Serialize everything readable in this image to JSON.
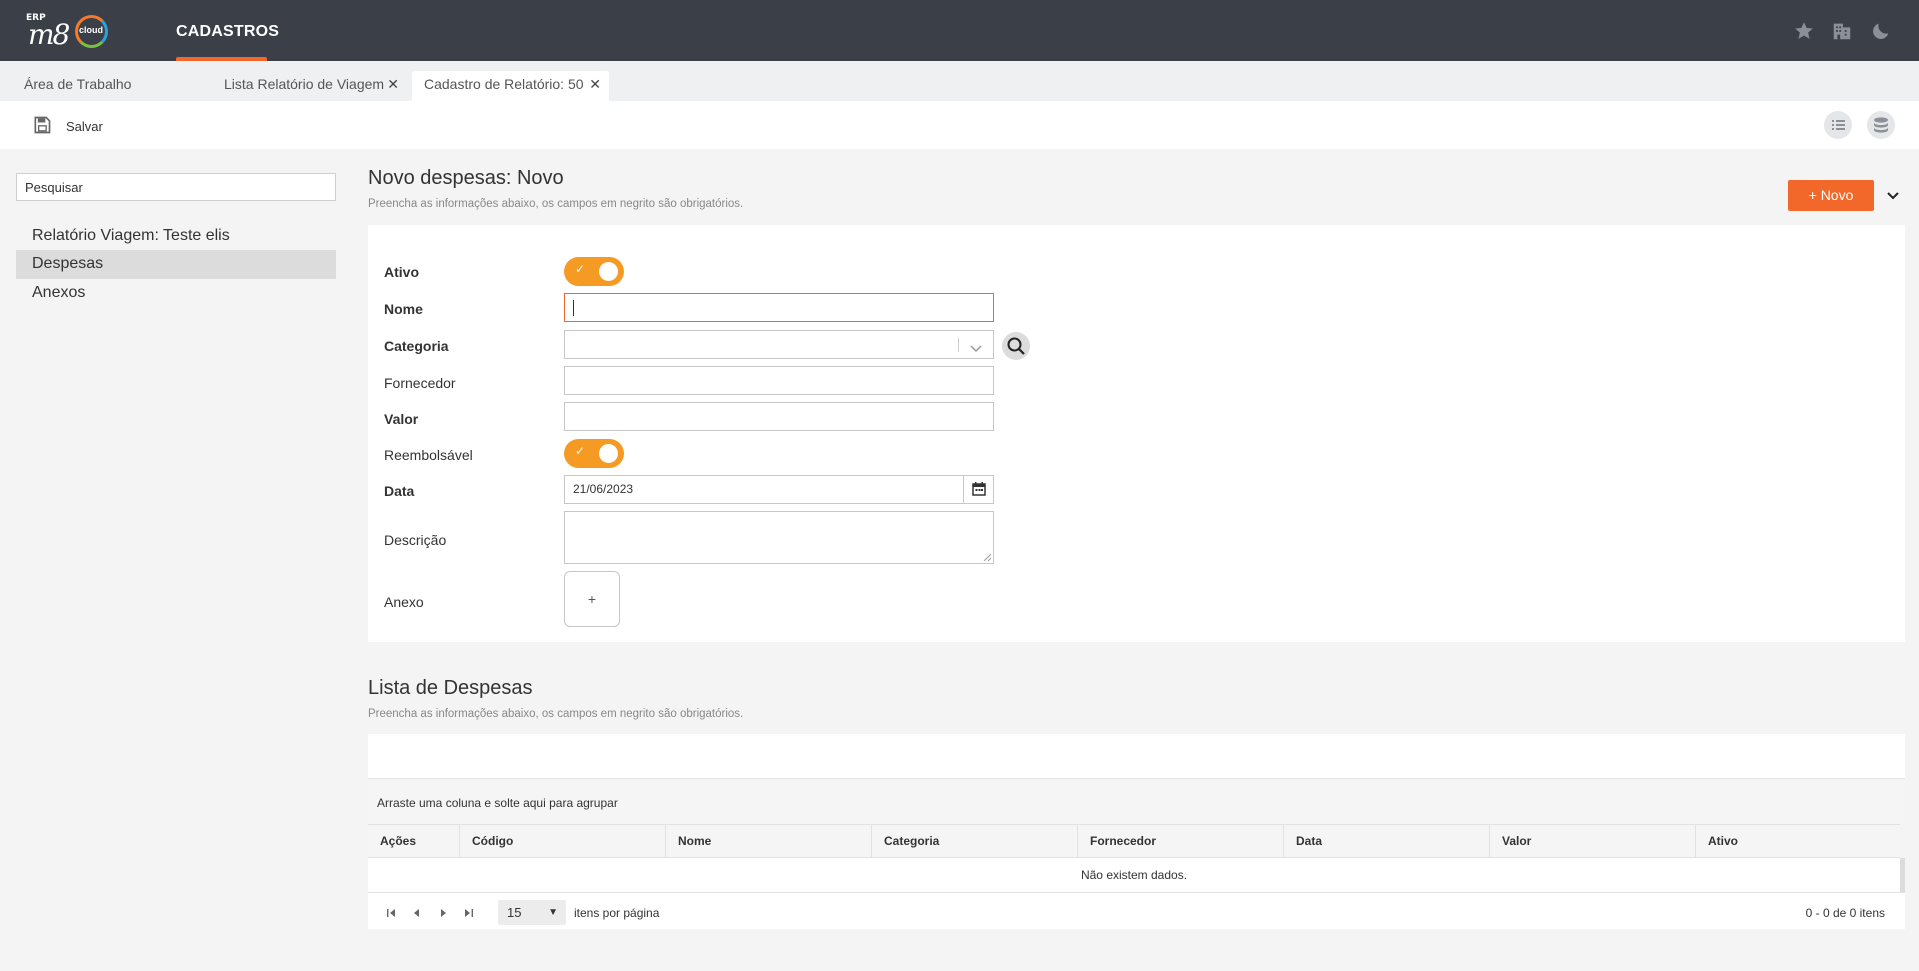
{
  "header": {
    "logo_erp": "ERP",
    "logo_m8": "m8",
    "logo_cloud": "cloud",
    "nav_active": "CADASTROS",
    "icons": [
      "star-icon",
      "building-icon",
      "moon-icon"
    ]
  },
  "tabs": [
    {
      "label": "Área de Trabalho",
      "closable": false
    },
    {
      "label": "Lista Relatório de Viagem",
      "closable": true
    },
    {
      "label": "Cadastro de Relatório: 50",
      "closable": true,
      "active": true
    }
  ],
  "toolbar": {
    "save_label": "Salvar",
    "right_icons": [
      "list-icon",
      "database-icon"
    ]
  },
  "sidebar": {
    "search_value": "Pesquisar",
    "items": [
      {
        "label": "Relatório Viagem: Teste elis"
      },
      {
        "label": "Despesas",
        "active": true
      },
      {
        "label": "Anexos"
      }
    ]
  },
  "form": {
    "title": "Novo despesas: Novo",
    "subtitle": "Preencha as informações abaixo, os campos em negrito são obrigatórios.",
    "new_button": "+ Novo",
    "fields": {
      "ativo": "Ativo",
      "nome": "Nome",
      "categoria": "Categoria",
      "fornecedor": "Fornecedor",
      "valor": "Valor",
      "reembolsavel": "Reembolsável",
      "data": "Data",
      "descricao": "Descrição",
      "anexo": "Anexo"
    },
    "data_value": "21/06/2023",
    "anexo_add": "+",
    "toggle_check": "✓",
    "accent_color": "#f2672a",
    "toggle_color": "#f59a23"
  },
  "list": {
    "title": "Lista de Despesas",
    "subtitle": "Preencha as informações abaixo, os campos em negrito são obrigatórios.",
    "group_hint": "Arraste uma coluna e solte aqui para agrupar",
    "columns": [
      "Ações",
      "Código",
      "Nome",
      "Categoria",
      "Fornecedor",
      "Data",
      "Valor",
      "Ativo"
    ],
    "empty_text": "Não existem dados.",
    "page_size": "15",
    "page_size_label": "itens por página",
    "page_info": "0 - 0 de 0 itens"
  }
}
